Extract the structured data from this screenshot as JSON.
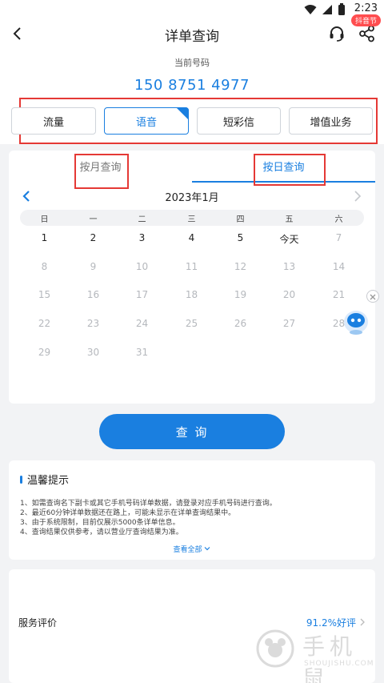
{
  "status_bar": {
    "time": "2:23"
  },
  "header": {
    "title": "详单查询",
    "badge": "抖音节"
  },
  "account": {
    "label": "当前号码",
    "number": "150 8751 4977"
  },
  "type_tabs": [
    {
      "label": "流量",
      "active": false
    },
    {
      "label": "语音",
      "active": true
    },
    {
      "label": "短彩信",
      "active": false
    },
    {
      "label": "增值业务",
      "active": false
    }
  ],
  "query_modes": {
    "month_label": "按月查询",
    "day_label": "按日查询",
    "selected": "按日查询"
  },
  "calendar": {
    "title": "2023年1月",
    "weekdays": [
      "日",
      "一",
      "二",
      "三",
      "四",
      "五",
      "六"
    ],
    "days": [
      {
        "label": "1",
        "enabled": true
      },
      {
        "label": "2",
        "enabled": true
      },
      {
        "label": "3",
        "enabled": true
      },
      {
        "label": "4",
        "enabled": true
      },
      {
        "label": "5",
        "enabled": true
      },
      {
        "label": "今天",
        "enabled": true
      },
      {
        "label": "7",
        "enabled": false
      },
      {
        "label": "8",
        "enabled": false
      },
      {
        "label": "9",
        "enabled": false
      },
      {
        "label": "10",
        "enabled": false
      },
      {
        "label": "11",
        "enabled": false
      },
      {
        "label": "12",
        "enabled": false
      },
      {
        "label": "13",
        "enabled": false
      },
      {
        "label": "14",
        "enabled": false
      },
      {
        "label": "15",
        "enabled": false
      },
      {
        "label": "16",
        "enabled": false
      },
      {
        "label": "17",
        "enabled": false
      },
      {
        "label": "18",
        "enabled": false
      },
      {
        "label": "19",
        "enabled": false
      },
      {
        "label": "20",
        "enabled": false
      },
      {
        "label": "21",
        "enabled": false
      },
      {
        "label": "22",
        "enabled": false
      },
      {
        "label": "23",
        "enabled": false
      },
      {
        "label": "24",
        "enabled": false
      },
      {
        "label": "25",
        "enabled": false
      },
      {
        "label": "26",
        "enabled": false
      },
      {
        "label": "27",
        "enabled": false
      },
      {
        "label": "28",
        "enabled": false
      },
      {
        "label": "29",
        "enabled": false
      },
      {
        "label": "30",
        "enabled": false
      },
      {
        "label": "31",
        "enabled": false
      }
    ]
  },
  "query_button": {
    "label": "查 询"
  },
  "tips": {
    "title": "温馨提示",
    "items": [
      "1、如需查询名下副卡或其它手机号码详单数据，请登录对应手机号码进行查询。",
      "2、最近60分钟详单数据还在路上，可能未显示在详单查询结果中。",
      "3、由于系统限制，目前仅展示5000条详单信息。",
      "4、查询结果仅供参考，请以营业厅查询结果为准。"
    ],
    "more": "查看全部"
  },
  "rating": {
    "label": "服务评价",
    "value": "91.2%好评"
  },
  "watermark": {
    "text": "手机鼠",
    "sub": "SHOUJISHU.COM"
  },
  "colors": {
    "accent": "#1a7fe0",
    "highlight_frame": "#e53935",
    "background": "#f2f3f5"
  },
  "icons": [
    "back-icon",
    "headset-icon",
    "share-icon",
    "chevron-left-icon",
    "chevron-right-icon",
    "close-icon",
    "robot-assistant-icon",
    "chevron-down-icon"
  ]
}
